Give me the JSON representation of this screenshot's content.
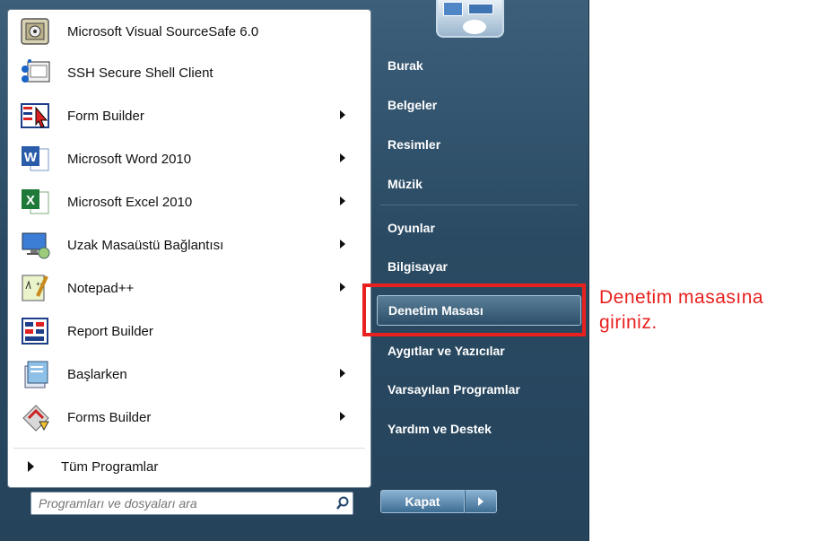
{
  "programs": [
    {
      "label": "Microsoft Visual SourceSafe 6.0",
      "icon": "vss-icon",
      "submenu": false
    },
    {
      "label": "SSH Secure Shell Client",
      "icon": "ssh-icon",
      "submenu": false
    },
    {
      "label": "Form Builder",
      "icon": "form-builder-icon",
      "submenu": true
    },
    {
      "label": "Microsoft Word 2010",
      "icon": "word-icon",
      "submenu": true
    },
    {
      "label": "Microsoft Excel 2010",
      "icon": "excel-icon",
      "submenu": true
    },
    {
      "label": "Uzak Masaüstü Bağlantısı",
      "icon": "remote-desktop-icon",
      "submenu": true
    },
    {
      "label": "Notepad++",
      "icon": "notepadpp-icon",
      "submenu": true
    },
    {
      "label": "Report Builder",
      "icon": "report-builder-icon",
      "submenu": false
    },
    {
      "label": "Başlarken",
      "icon": "getting-started-icon",
      "submenu": true
    },
    {
      "label": "Forms Builder",
      "icon": "forms-builder-icon",
      "submenu": true
    }
  ],
  "all_programs_label": "Tüm Programlar",
  "search": {
    "placeholder": "Programları ve dosyaları ara"
  },
  "right_menu": [
    {
      "label": "Burak"
    },
    {
      "label": "Belgeler"
    },
    {
      "label": "Resimler"
    },
    {
      "label": "Müzik"
    },
    {
      "label": "Oyunlar"
    },
    {
      "label": "Bilgisayar"
    },
    {
      "label": "Denetim Masası"
    },
    {
      "label": "Aygıtlar ve Yazıcılar"
    },
    {
      "label": "Varsayılan Programlar"
    },
    {
      "label": "Yardım ve Destek"
    }
  ],
  "shutdown_label": "Kapat",
  "annotation": {
    "line1": "Denetim masasına",
    "line2": "giriniz."
  },
  "colors": {
    "accent": "#e8201e",
    "menu_bg": "#2a4a63"
  }
}
